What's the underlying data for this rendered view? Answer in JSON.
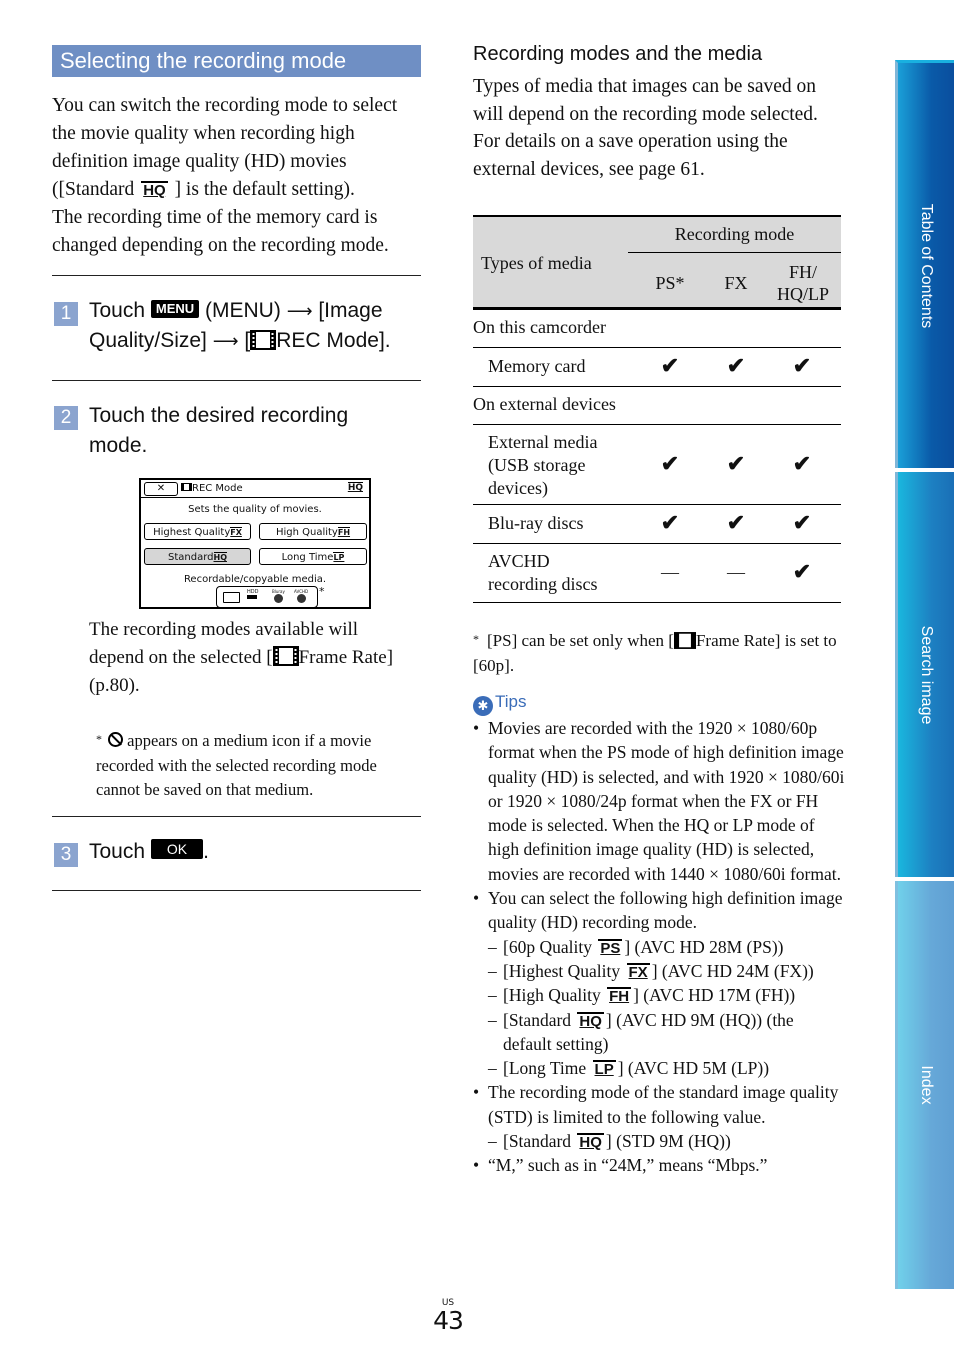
{
  "left": {
    "section_title": "Selecting the recording mode",
    "intro": {
      "line1": "You can switch the recording mode to select the movie quality when recording high definition image quality (HD) movies ([Standard",
      "hq_tag": "HQ",
      "line2": "] is the default setting).",
      "line3": "The recording time of the memory card is changed depending on the recording mode."
    },
    "steps": [
      {
        "number": "1",
        "touch": "Touch",
        "menu_badge": "MENU",
        "text_a": "(MENU)",
        "text_b": "[Image Quality/Size]",
        "text_c": "[",
        "text_d": "REC Mode]."
      },
      {
        "number": "2",
        "text": "Touch the desired recording mode."
      },
      {
        "number": "3",
        "touch": "Touch",
        "ok_badge": "OK",
        "period": "."
      }
    ],
    "screen": {
      "close": "✕",
      "title": "REC Mode",
      "current_tag": "HQ",
      "subtitle": "Sets the quality of movies.",
      "buttons": [
        {
          "label": "Highest Quality",
          "tag": "FX",
          "selected": false
        },
        {
          "label": "High Quality",
          "tag": "FH",
          "selected": false
        },
        {
          "label": "Standard",
          "tag": "HQ",
          "selected": true
        },
        {
          "label": "Long Time",
          "tag": "LP",
          "selected": false
        }
      ],
      "media_label": "Recordable/copyable media.",
      "media_icons": [
        "memory-card",
        "HDD",
        "Blu-ray",
        "AVCHD"
      ],
      "asterisk": "*"
    },
    "note": {
      "text_a": "The recording modes available will depend on the selected [",
      "text_b": "Frame Rate] (p.80)."
    },
    "footnote": {
      "star": "*",
      "text": "appears on a medium icon if a movie recorded with the selected recording mode cannot be saved on that medium."
    }
  },
  "right": {
    "subtitle": "Recording modes and the media",
    "intro_p1": "Types of media that images can be saved on will depend on the recording mode selected.",
    "intro_p2": "For details on a save operation using the external devices, see page 61.",
    "table": {
      "col_media": "Types of media",
      "col_group": "Recording mode",
      "cols": [
        "PS*",
        "FX",
        "FH/\nHQ/LP"
      ],
      "groups": [
        {
          "label": "On this camcorder",
          "rows": [
            {
              "label": "Memory card",
              "values": [
                "✔",
                "✔",
                "✔"
              ]
            }
          ]
        },
        {
          "label": "On external devices",
          "rows": [
            {
              "label": "External media (USB storage devices)",
              "values": [
                "✔",
                "✔",
                "✔"
              ]
            },
            {
              "label": "Blu-ray discs",
              "values": [
                "✔",
                "✔",
                "✔"
              ]
            },
            {
              "label": "AVCHD recording discs",
              "values": [
                "—",
                "—",
                "✔"
              ]
            }
          ]
        }
      ]
    },
    "table_note": {
      "star": "*",
      "text_a": "[PS] can be set only when [",
      "text_b": "Frame Rate] is set to [60p]."
    },
    "tips": {
      "title": "Tips",
      "bullet1": "Movies are recorded with the 1920 × 1080/60p format when the PS mode of high definition image quality (HD) is selected, and with 1920 × 1080/60i or 1920 × 1080/24p format when the FX or FH mode is selected. When the HQ or LP mode of high definition image quality (HD) is selected, movies are recorded with 1440 × 1080/60i format.",
      "bullet2": "You can select the following high definition image quality (HD) recording mode.",
      "hd_modes": [
        {
          "pre": "[60p Quality",
          "tag": "PS",
          "post": "] (AVC HD 28M (PS))"
        },
        {
          "pre": "[Highest Quality",
          "tag": "FX",
          "post": "] (AVC HD 24M (FX))"
        },
        {
          "pre": "[High Quality",
          "tag": "FH",
          "post": "] (AVC HD 17M (FH))"
        },
        {
          "pre": "[Standard",
          "tag": "HQ",
          "post": "] (AVC HD 9M (HQ)) (the default setting)"
        },
        {
          "pre": "[Long Time",
          "tag": "LP",
          "post": "] (AVC HD 5M (LP))"
        }
      ],
      "bullet3": "The recording mode of the standard image quality (STD) is limited to the following value.",
      "std_mode": {
        "pre": "[Standard",
        "tag": "HQ",
        "post": "] (STD 9M (HQ))"
      },
      "bullet4": "“M,” such as in “24M,” means “Mbps.”"
    }
  },
  "side_tabs": [
    "Table of Contents",
    "Search image",
    "Index"
  ],
  "page": {
    "region": "US",
    "number": "43"
  }
}
